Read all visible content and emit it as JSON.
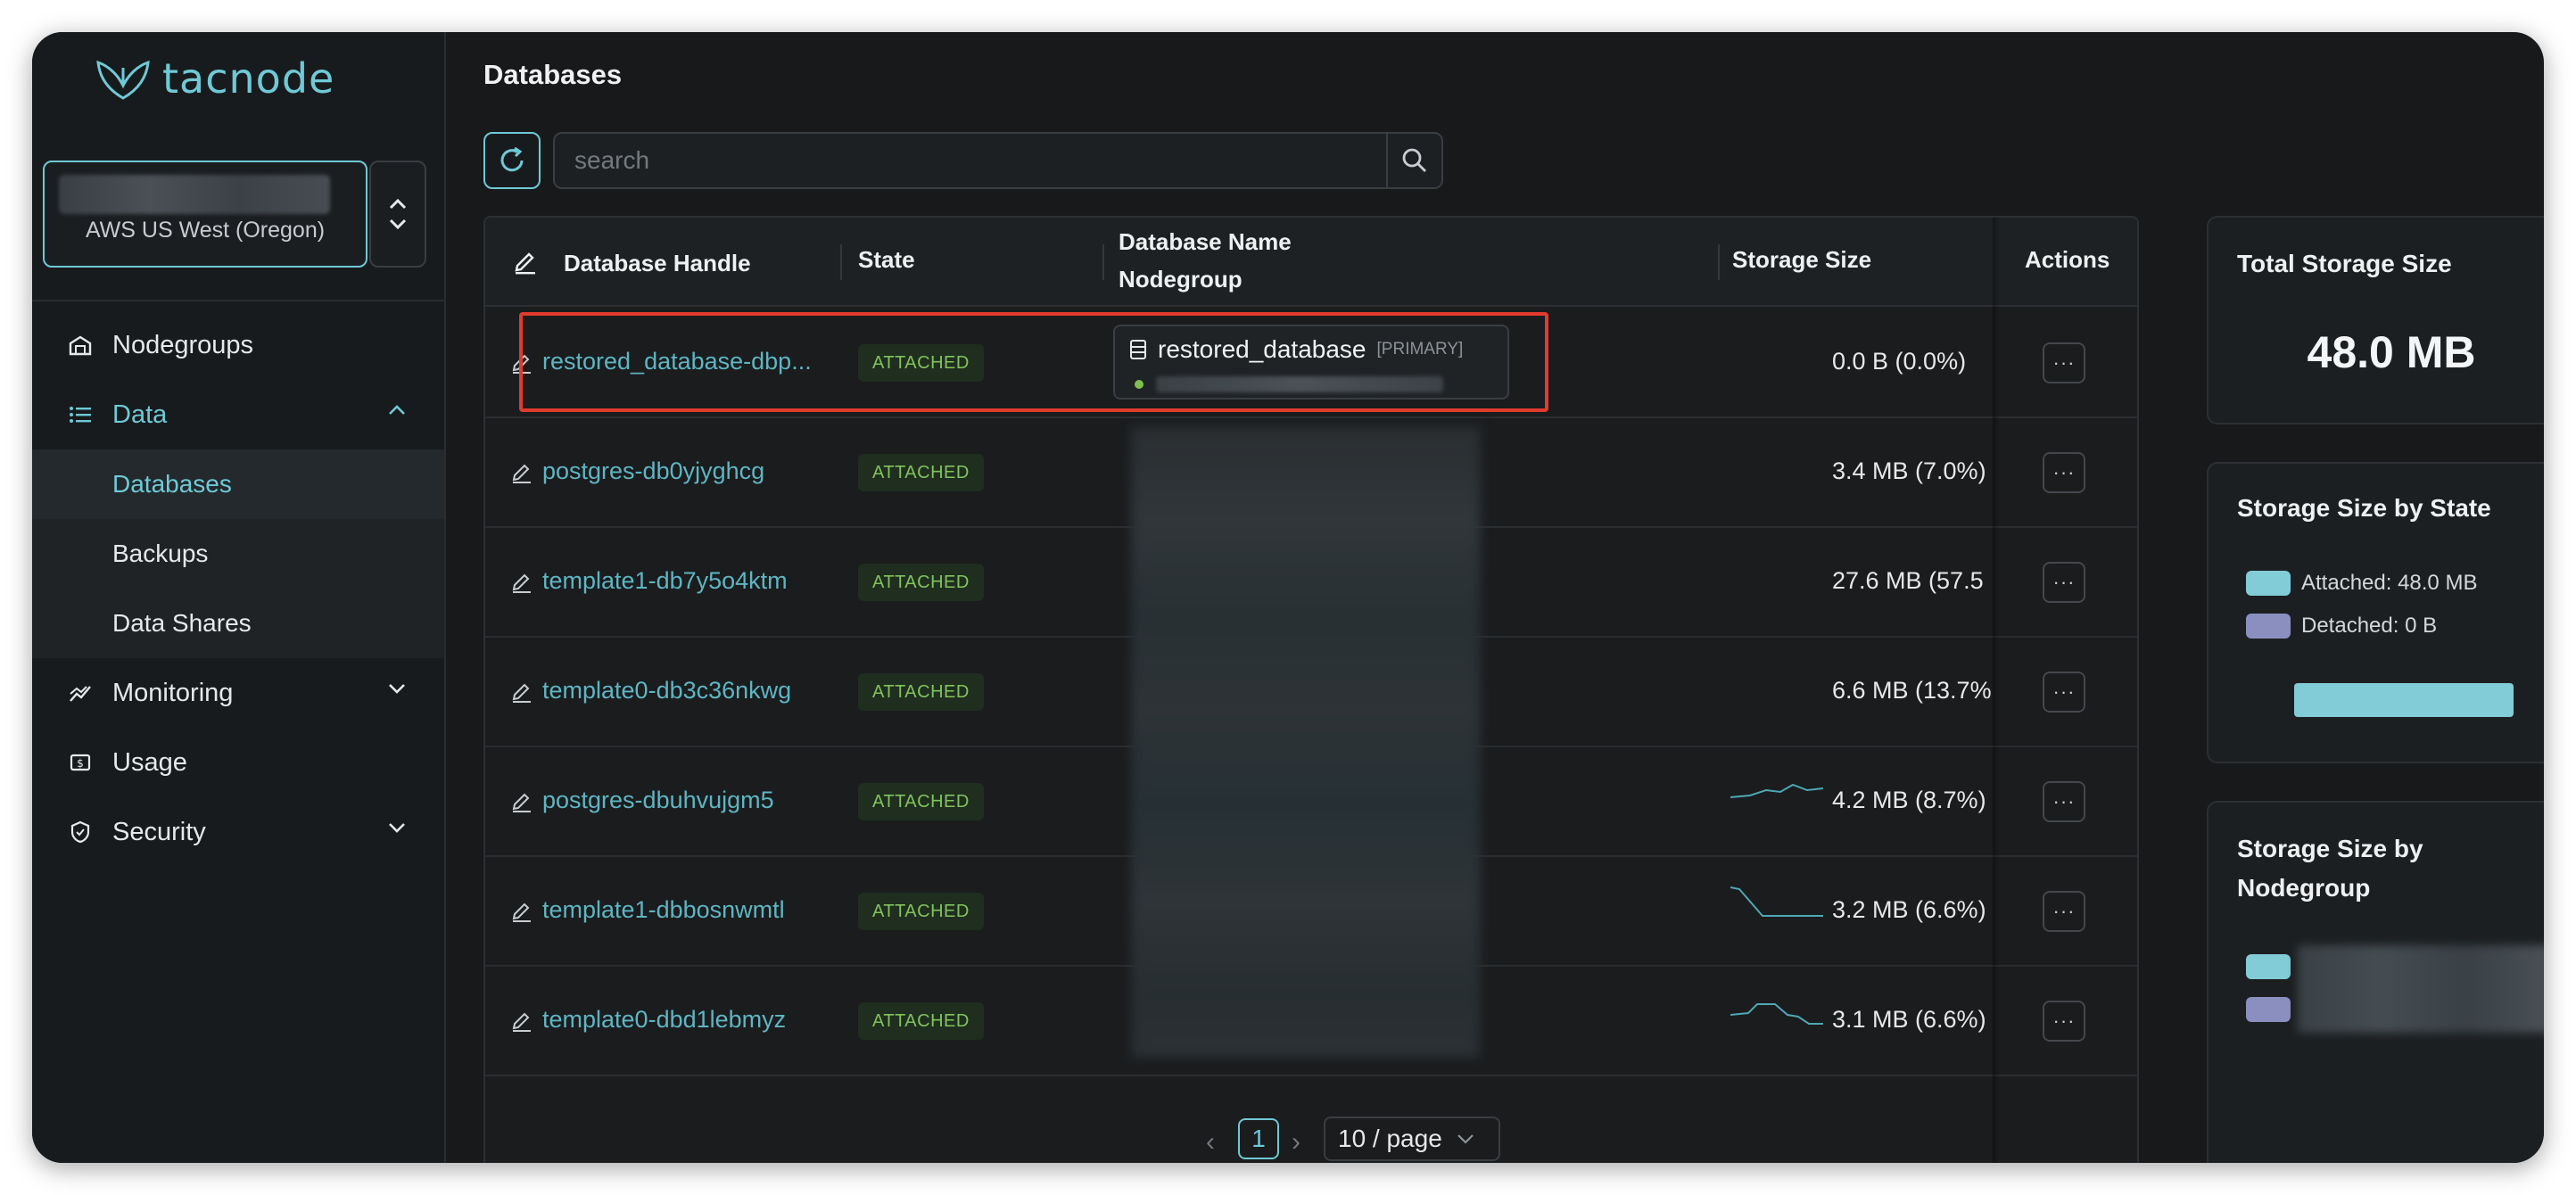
{
  "app": {
    "logo_text": "tacnode"
  },
  "region": {
    "label": "AWS US West (Oregon)"
  },
  "nav": {
    "nodegroups": "Nodegroups",
    "data": "Data",
    "databases": "Databases",
    "backups": "Backups",
    "data_shares": "Data Shares",
    "monitoring": "Monitoring",
    "usage": "Usage",
    "security": "Security"
  },
  "page": {
    "title": "Databases"
  },
  "search": {
    "placeholder": "search"
  },
  "table": {
    "columns": {
      "handle": "Database Handle",
      "state": "State",
      "name": "Database Name",
      "nodegroup": "Nodegroup",
      "storage": "Storage Size",
      "actions": "Actions"
    },
    "rows": [
      {
        "handle": "restored_database-dbp...",
        "state": "ATTACHED",
        "db_name": "restored_database",
        "tag": "[PRIMARY]",
        "size": "0.0 B  (0.0%)"
      },
      {
        "handle": "postgres-db0yjyghcg",
        "state": "ATTACHED",
        "size": "3.4 MB  (7.0%)"
      },
      {
        "handle": "template1-db7y5o4ktm",
        "state": "ATTACHED",
        "size": "27.6 MB  (57.5"
      },
      {
        "handle": "template0-db3c36nkwg",
        "state": "ATTACHED",
        "size": "6.6 MB  (13.7%"
      },
      {
        "handle": "postgres-dbuhvujgm5",
        "state": "ATTACHED",
        "size": "4.2 MB  (8.7%)"
      },
      {
        "handle": "template1-dbbosnwmtl",
        "state": "ATTACHED",
        "size": "3.2 MB  (6.6%)"
      },
      {
        "handle": "template0-dbd1lebmyz",
        "state": "ATTACHED",
        "size": "3.1 MB  (6.6%)"
      }
    ],
    "actions_label": "···"
  },
  "pagination": {
    "prev": "‹",
    "current": "1",
    "next": "›",
    "page_size": "10 / page"
  },
  "panels": {
    "total": {
      "title": "Total Storage Size",
      "value": "48.0 MB"
    },
    "by_state": {
      "title": "Storage Size by State",
      "attached": "Attached: 48.0 MB",
      "detached": "Detached: 0 B",
      "attached_fraction": 1.0
    },
    "by_nodegroup": {
      "title_line1": "Storage Size by",
      "title_line2": "Nodegroup"
    }
  },
  "colors": {
    "accent": "#6fc9d6",
    "attached": "#82ccd7",
    "detached": "#8b8fc0",
    "badge_text": "#82c25d",
    "highlight": "#e23b2d"
  }
}
